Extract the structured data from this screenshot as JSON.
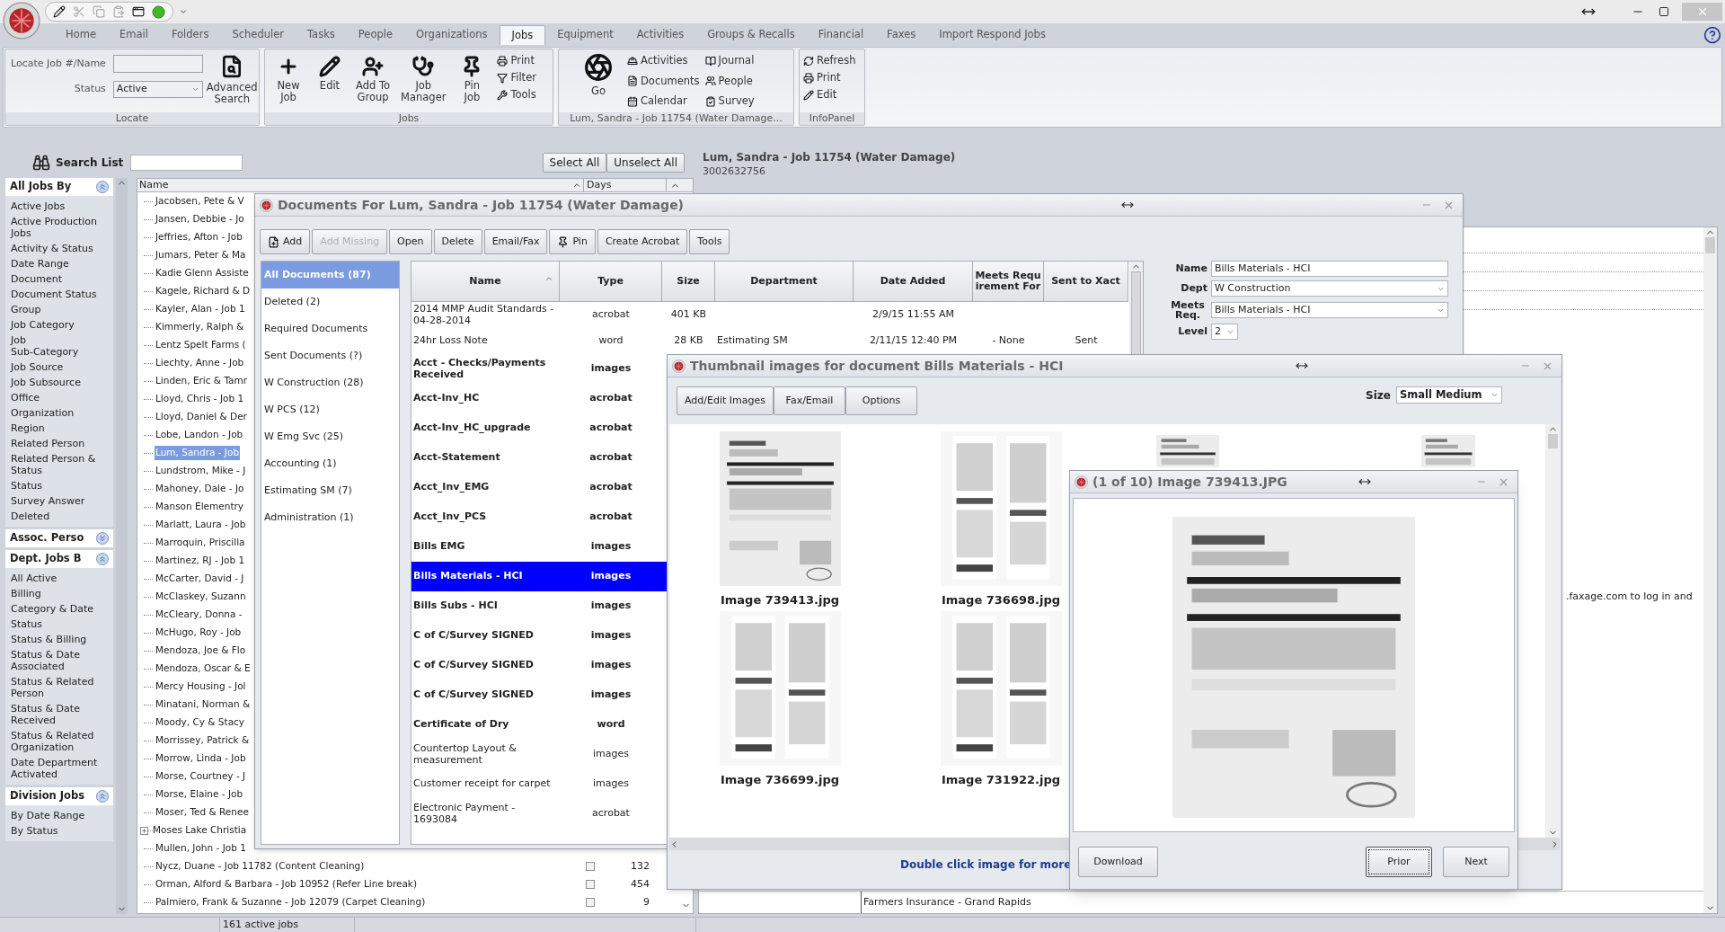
{
  "ribbon_tabs": [
    {
      "label": "Home",
      "selected": false
    },
    {
      "label": "Email",
      "selected": false
    },
    {
      "label": "Folders",
      "selected": false
    },
    {
      "label": "Scheduler",
      "selected": false
    },
    {
      "label": "Tasks",
      "selected": false
    },
    {
      "label": "People",
      "selected": false
    },
    {
      "label": "Organizations",
      "selected": false
    },
    {
      "label": "Jobs",
      "selected": true
    },
    {
      "label": "Equipment",
      "selected": false
    },
    {
      "label": "Activities",
      "selected": false
    },
    {
      "label": "Groups & Recalls",
      "selected": false
    },
    {
      "label": "Financial",
      "selected": false
    },
    {
      "label": "Faxes",
      "selected": false
    },
    {
      "label": "Import Respond Jobs",
      "selected": false
    }
  ],
  "ribbon": {
    "locate": {
      "job_label": "Locate Job #/Name",
      "status_label": "Status",
      "status_value": "Active",
      "search_button": "Advanced\nSearch",
      "group_label": "Locate"
    },
    "jobs": {
      "large": [
        {
          "label": "New\nJob"
        },
        {
          "label": "Edit"
        },
        {
          "label": "Add To\nGroup"
        },
        {
          "label": "Job\nManager"
        },
        {
          "label": "Pin\nJob"
        }
      ],
      "small": [
        {
          "label": "Print"
        },
        {
          "label": "Filter"
        },
        {
          "label": "Tools"
        }
      ],
      "group_label": "Jobs"
    },
    "go": {
      "go_button": "Go",
      "small": [
        {
          "label": "Activities"
        },
        {
          "label": "Documents"
        },
        {
          "label": "Calendar"
        },
        {
          "label": "Journal"
        },
        {
          "label": "People"
        },
        {
          "label": "Survey"
        }
      ],
      "group_label": "Lum, Sandra - Job 11754 (Water Damage..."
    },
    "infopanel": {
      "small": [
        {
          "label": "Refresh"
        },
        {
          "label": "Print"
        },
        {
          "label": "Edit"
        }
      ],
      "group_label": "InfoPanel"
    }
  },
  "search_list": {
    "label": "Search List",
    "buttons": [
      "Select All",
      "Unselect All"
    ]
  },
  "nav_sections": [
    {
      "title": "All Jobs By",
      "expanded": true,
      "items": [
        "Active Jobs",
        "Active Production Jobs",
        "Activity & Status",
        "Date Range",
        "Document",
        "Document Status",
        "Group",
        "Job Category",
        "Job\nSub-Category",
        "Job Source",
        "Job Subsource",
        "Office",
        "Organization",
        "Region",
        "Related Person",
        "Related Person & Status",
        "Status",
        "Survey Answer",
        "Deleted"
      ]
    },
    {
      "title": "Assoc. Perso",
      "expanded": false
    },
    {
      "title": "Dept. Jobs B",
      "expanded": true,
      "items": [
        "All Active",
        "Billing",
        "Category & Date",
        "Status",
        "Status & Billing",
        "Status & Date Associated",
        "Status & Related Person",
        "Status & Date Received",
        "Status & Related Organization",
        "Date Department Activated"
      ]
    },
    {
      "title": "Division Jobs",
      "expanded": true,
      "items": [
        "By Date Range",
        "By Status"
      ]
    }
  ],
  "job_list": {
    "columns": [
      "Name",
      "Days"
    ],
    "rows": [
      {
        "name": "Jacobsen, Pete & V",
        "kind": "leaf",
        "selected": false
      },
      {
        "name": "Jansen, Debbie - Jo",
        "kind": "leaf",
        "selected": false
      },
      {
        "name": "Jeffries, Afton - Job",
        "kind": "leaf",
        "selected": false
      },
      {
        "name": "Jumars, Peter & Ma",
        "kind": "leaf",
        "selected": false
      },
      {
        "name": "Kadie Glenn Assiste",
        "kind": "leaf",
        "selected": false
      },
      {
        "name": "Kagele, Richard & D",
        "kind": "leaf",
        "selected": false
      },
      {
        "name": "Kayler, Alan - Job 1",
        "kind": "leaf",
        "selected": false
      },
      {
        "name": "Kimmerly, Ralph &",
        "kind": "leaf",
        "selected": false
      },
      {
        "name": "Lentz Spelt Farms (",
        "kind": "leaf",
        "selected": false
      },
      {
        "name": "Liechty, Anne - Job",
        "kind": "leaf",
        "selected": false
      },
      {
        "name": "Linden, Eric & Tamr",
        "kind": "leaf",
        "selected": false
      },
      {
        "name": "Lloyd, Chris - Job 1",
        "kind": "leaf",
        "selected": false
      },
      {
        "name": "Lloyd, Daniel & Der",
        "kind": "leaf",
        "selected": false
      },
      {
        "name": "Lobe, Landon - Job",
        "kind": "leaf",
        "selected": false
      },
      {
        "name": "Lum, Sandra - Job",
        "kind": "leaf",
        "selected": true
      },
      {
        "name": "Lundstrom, Mike - J",
        "kind": "leaf",
        "selected": false
      },
      {
        "name": "Mahoney, Dale - Jo",
        "kind": "leaf",
        "selected": false
      },
      {
        "name": "Manson Elementry",
        "kind": "leaf",
        "selected": false
      },
      {
        "name": "Marlatt, Laura - Job",
        "kind": "leaf",
        "selected": false
      },
      {
        "name": "Marroquin, Priscilla",
        "kind": "leaf",
        "selected": false
      },
      {
        "name": "Martinez, RJ - Job 1",
        "kind": "leaf",
        "selected": false
      },
      {
        "name": "McCarter, David - J",
        "kind": "leaf",
        "selected": false
      },
      {
        "name": "McClaskey, Suzann",
        "kind": "leaf",
        "selected": false
      },
      {
        "name": "McCleary, Donna -",
        "kind": "leaf",
        "selected": false
      },
      {
        "name": "McHugo, Roy - Job",
        "kind": "leaf",
        "selected": false
      },
      {
        "name": "Mendoza, Joe & Flo",
        "kind": "leaf",
        "selected": false
      },
      {
        "name": "Mendoza, Oscar & E",
        "kind": "leaf",
        "selected": false
      },
      {
        "name": "Mercy Housing - Jol",
        "kind": "leaf",
        "selected": false
      },
      {
        "name": "Minatani, Norman &",
        "kind": "leaf",
        "selected": false
      },
      {
        "name": "Moody, Cy & Stacy",
        "kind": "leaf",
        "selected": false
      },
      {
        "name": "Morrissey, Patrick &",
        "kind": "leaf",
        "selected": false
      },
      {
        "name": "Morrow, Linda - Job",
        "kind": "leaf",
        "selected": false
      },
      {
        "name": "Morse, Courtney - J",
        "kind": "leaf",
        "selected": false
      },
      {
        "name": "Morse, Elaine - Job",
        "kind": "leaf",
        "selected": false
      },
      {
        "name": "Moser, Ted & Renee",
        "kind": "leaf",
        "selected": false
      },
      {
        "name": "Moses Lake Christia",
        "kind": "group",
        "selected": false
      },
      {
        "name": "Mullen, John - Job 1",
        "kind": "leaf",
        "selected": false
      },
      {
        "name": "Nycz, Duane - Job 11782 (Content Cleaning)",
        "kind": "leaf",
        "selected": false,
        "checked": false,
        "days": "132"
      },
      {
        "name": "Orman, Alford & Barbara - Job 10952 (Refer Line break)",
        "kind": "leaf",
        "selected": false,
        "checked": false,
        "days": "454"
      },
      {
        "name": "Palmiero, Frank & Suzanne - Job 12079 (Carpet Cleaning)",
        "kind": "leaf",
        "selected": false,
        "checked": false,
        "days": "9"
      }
    ]
  },
  "job_header": {
    "title": "Lum, Sandra - Job 11754 (Water Damage)",
    "phone": "3002632756"
  },
  "background_panel": {
    "note": ".faxage.com to log in and",
    "insurance": "Farmers Insurance - Grand Rapids"
  },
  "status_bar": {
    "text": "161 active jobs"
  },
  "documents_window": {
    "title": "Documents For Lum, Sandra - Job 11754 (Water Damage)",
    "toolbar": [
      {
        "label": "Add",
        "disabled": false
      },
      {
        "label": "Add Missing",
        "disabled": true
      },
      {
        "label": "Open",
        "disabled": false
      },
      {
        "label": "Delete",
        "disabled": false
      },
      {
        "label": "Email/Fax",
        "disabled": false
      },
      {
        "label": "Pin",
        "disabled": false
      },
      {
        "label": "Create Acrobat",
        "disabled": false
      },
      {
        "label": "Tools",
        "disabled": false
      }
    ],
    "categories": [
      {
        "label": "All Documents (87)",
        "selected": true
      },
      {
        "label": "Deleted (2)",
        "selected": false
      },
      {
        "label": "Required Documents",
        "selected": false
      },
      {
        "label": "Sent Documents (?)",
        "selected": false
      },
      {
        "label": "W Construction (28)",
        "selected": false
      },
      {
        "label": "W PCS (12)",
        "selected": false
      },
      {
        "label": "W Emg Svc (25)",
        "selected": false
      },
      {
        "label": "Accounting (1)",
        "selected": false
      },
      {
        "label": "Estimating SM (7)",
        "selected": false
      },
      {
        "label": "Administration (1)",
        "selected": false
      }
    ],
    "table": {
      "columns": [
        "Name",
        "Type",
        "Size",
        "Department",
        "Date Added",
        "Meets Requirement For",
        "Sent to Xact"
      ],
      "rows": [
        {
          "name": "2014 MMP Audit Standards - 04-28-2014",
          "type": "acrobat",
          "size": "401 KB",
          "date_added": "2/9/15 11:55 AM",
          "bold": false,
          "selected": false
        },
        {
          "name": "24hr Loss Note",
          "type": "word",
          "size": "28 KB",
          "department": "Estimating SM",
          "date_added": "2/11/15 12:40 PM",
          "meets": "- None",
          "sent": "Sent",
          "bold": false,
          "selected": false
        },
        {
          "name": "Acct - Checks/Payments Received",
          "type": "images",
          "bold": true,
          "selected": false
        },
        {
          "name": "Acct-Inv_HC",
          "type": "acrobat",
          "bold": true,
          "selected": false
        },
        {
          "name": "Acct-Inv_HC_upgrade",
          "type": "acrobat",
          "bold": true,
          "selected": false
        },
        {
          "name": "Acct-Statement",
          "type": "acrobat",
          "bold": true,
          "selected": false
        },
        {
          "name": "Acct_Inv_EMG",
          "type": "acrobat",
          "bold": true,
          "selected": false
        },
        {
          "name": "Acct_Inv_PCS",
          "type": "acrobat",
          "bold": true,
          "selected": false
        },
        {
          "name": "Bills EMG",
          "type": "images",
          "bold": true,
          "selected": false
        },
        {
          "name": "Bills Materials - HCI",
          "type": "images",
          "bold": true,
          "selected": true
        },
        {
          "name": "Bills Subs - HCI",
          "type": "images",
          "bold": true,
          "selected": false
        },
        {
          "name": "C of C/Survey SIGNED",
          "type": "images",
          "bold": true,
          "selected": false
        },
        {
          "name": "C of C/Survey SIGNED",
          "type": "images",
          "bold": true,
          "selected": false
        },
        {
          "name": "C of C/Survey SIGNED",
          "type": "images",
          "bold": true,
          "selected": false
        },
        {
          "name": "Certificate of Dry",
          "type": "word",
          "bold": true,
          "selected": false
        },
        {
          "name": "Countertop Layout & measurement",
          "type": "images",
          "bold": false,
          "selected": false
        },
        {
          "name": "Customer receipt for carpet",
          "type": "images",
          "bold": false,
          "selected": false
        },
        {
          "name": "Electronic Payment - 1693084",
          "type": "acrobat",
          "bold": false,
          "selected": false
        }
      ]
    },
    "details": {
      "name_label": "Name",
      "name": "Bills Materials - HCI",
      "dept_label": "Dept",
      "dept": "W Construction",
      "meets_label": "Meets\nReq.",
      "meets": "Bills Materials - HCI",
      "level_label": "Level",
      "level_choice": "2"
    }
  },
  "thumbnail_window": {
    "title": "Thumbnail images for document Bills Materials - HCI",
    "buttons": [
      "Add/Edit Images",
      "Fax/Email",
      "Options"
    ],
    "size_label": "Size",
    "size_value": "Small Medium",
    "thumbnails": [
      {
        "caption": "Image 739413.jpg",
        "kind": "invoice"
      },
      {
        "caption": "Image 736698.jpg",
        "kind": "receipt"
      },
      {
        "caption": "Image 736699.jpg",
        "kind": "receipt"
      },
      {
        "caption": "Image 731922.jpg",
        "kind": "receipt"
      }
    ],
    "hint": "Double click image for more"
  },
  "image_window": {
    "title": "(1 of 10) Image 739413.JPG",
    "buttons": [
      {
        "label": "Download",
        "focused": false
      },
      {
        "label": "Prior",
        "focused": true
      },
      {
        "label": "Next",
        "focused": false
      }
    ]
  }
}
